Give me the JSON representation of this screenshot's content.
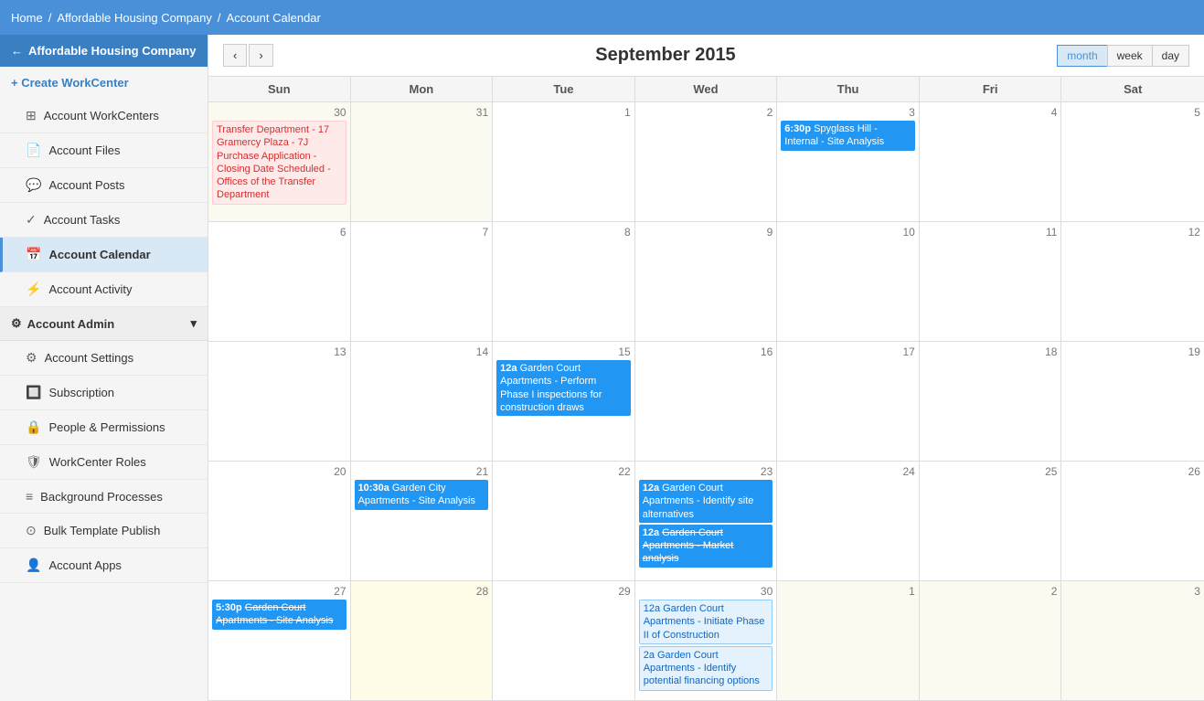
{
  "topBar": {
    "home": "Home",
    "sep1": "/",
    "company": "Affordable Housing Company",
    "sep2": "/",
    "page": "Account Calendar"
  },
  "sidebar": {
    "companyName": "Affordable Housing Company",
    "createBtn": "+ Create WorkCenter",
    "items": [
      {
        "id": "workcenters",
        "icon": "⊞",
        "label": "Account WorkCenters",
        "active": false
      },
      {
        "id": "files",
        "icon": "📄",
        "label": "Account Files",
        "active": false
      },
      {
        "id": "posts",
        "icon": "💬",
        "label": "Account Posts",
        "active": false
      },
      {
        "id": "tasks",
        "icon": "✓",
        "label": "Account Tasks",
        "active": false
      },
      {
        "id": "calendar",
        "icon": "📅",
        "label": "Account Calendar",
        "active": true
      },
      {
        "id": "activity",
        "icon": "⚡",
        "label": "Account Activity",
        "active": false
      }
    ],
    "adminSection": {
      "label": "Account Admin",
      "icon": "⚙",
      "items": [
        {
          "id": "settings",
          "icon": "⚙",
          "label": "Account Settings"
        },
        {
          "id": "subscription",
          "icon": "🔲",
          "label": "Subscription"
        },
        {
          "id": "people",
          "icon": "🔒",
          "label": "People & Permissions"
        },
        {
          "id": "roles",
          "icon": "🛡",
          "label": "WorkCenter Roles"
        },
        {
          "id": "background",
          "icon": "≡",
          "label": "Background Processes"
        },
        {
          "id": "bulk",
          "icon": "⊙",
          "label": "Bulk Template Publish"
        },
        {
          "id": "apps",
          "icon": "👤",
          "label": "Account Apps"
        }
      ]
    }
  },
  "calendar": {
    "title": "September 2015",
    "prevBtn": "‹",
    "nextBtn": "›",
    "views": [
      {
        "id": "month",
        "label": "month",
        "active": true
      },
      {
        "id": "week",
        "label": "week",
        "active": false
      },
      {
        "id": "day",
        "label": "day",
        "active": false
      }
    ],
    "dayNames": [
      "Sun",
      "Mon",
      "Tue",
      "Wed",
      "Thu",
      "Fri",
      "Sat"
    ],
    "weeks": [
      {
        "days": [
          {
            "num": "30",
            "otherMonth": true,
            "today": false,
            "events": [
              {
                "type": "red-text",
                "time": "",
                "title": "Transfer Department - 17 Gramercy Plaza - 7J Purchase Application - Closing Date Scheduled - Offices of the Transfer Department",
                "strikethrough": false
              }
            ]
          },
          {
            "num": "31",
            "otherMonth": true,
            "today": false,
            "events": []
          },
          {
            "num": "1",
            "otherMonth": false,
            "today": false,
            "events": []
          },
          {
            "num": "2",
            "otherMonth": false,
            "today": false,
            "events": []
          },
          {
            "num": "3",
            "otherMonth": false,
            "today": false,
            "events": [
              {
                "type": "blue-fill",
                "time": "6:30p",
                "title": "Spyglass Hill - Internal - Site Analysis",
                "strikethrough": false
              }
            ]
          },
          {
            "num": "4",
            "otherMonth": false,
            "today": false,
            "events": []
          },
          {
            "num": "5",
            "otherMonth": false,
            "today": false,
            "events": []
          }
        ]
      },
      {
        "days": [
          {
            "num": "6",
            "otherMonth": false,
            "today": false,
            "events": []
          },
          {
            "num": "7",
            "otherMonth": false,
            "today": false,
            "events": []
          },
          {
            "num": "8",
            "otherMonth": false,
            "today": false,
            "events": []
          },
          {
            "num": "9",
            "otherMonth": false,
            "today": false,
            "events": []
          },
          {
            "num": "10",
            "otherMonth": false,
            "today": false,
            "events": []
          },
          {
            "num": "11",
            "otherMonth": false,
            "today": false,
            "events": []
          },
          {
            "num": "12",
            "otherMonth": false,
            "today": false,
            "events": []
          }
        ]
      },
      {
        "days": [
          {
            "num": "13",
            "otherMonth": false,
            "today": false,
            "events": []
          },
          {
            "num": "14",
            "otherMonth": false,
            "today": false,
            "events": []
          },
          {
            "num": "15",
            "otherMonth": false,
            "today": false,
            "events": [
              {
                "type": "blue-fill",
                "time": "12a",
                "title": "Garden Court Apartments - Perform Phase I inspections for construction draws",
                "strikethrough": false
              }
            ]
          },
          {
            "num": "16",
            "otherMonth": false,
            "today": false,
            "events": []
          },
          {
            "num": "17",
            "otherMonth": false,
            "today": false,
            "events": []
          },
          {
            "num": "18",
            "otherMonth": false,
            "today": false,
            "events": []
          },
          {
            "num": "19",
            "otherMonth": false,
            "today": false,
            "events": []
          }
        ]
      },
      {
        "days": [
          {
            "num": "20",
            "otherMonth": false,
            "today": false,
            "events": []
          },
          {
            "num": "21",
            "otherMonth": false,
            "today": false,
            "events": [
              {
                "type": "blue-fill",
                "time": "10:30a",
                "title": "Garden City Apartments - Site Analysis",
                "strikethrough": false
              }
            ]
          },
          {
            "num": "22",
            "otherMonth": false,
            "today": false,
            "events": []
          },
          {
            "num": "23",
            "otherMonth": false,
            "today": false,
            "events": [
              {
                "type": "blue-fill",
                "time": "12a",
                "title": "Garden Court Apartments - Identify site alternatives",
                "strikethrough": false
              },
              {
                "type": "blue-fill strikethrough",
                "time": "12a",
                "title": "Garden Court Apartments - Market analysis",
                "strikethrough": true
              }
            ]
          },
          {
            "num": "24",
            "otherMonth": false,
            "today": false,
            "events": []
          },
          {
            "num": "25",
            "otherMonth": false,
            "today": false,
            "events": []
          },
          {
            "num": "26",
            "otherMonth": false,
            "today": false,
            "events": []
          }
        ]
      },
      {
        "days": [
          {
            "num": "27",
            "otherMonth": false,
            "today": false,
            "events": [
              {
                "type": "blue-fill strikethrough",
                "time": "5:30p",
                "title": "Garden Court Apartments - Site Analysis",
                "strikethrough": true
              }
            ]
          },
          {
            "num": "28",
            "otherMonth": false,
            "today": true,
            "events": []
          },
          {
            "num": "29",
            "otherMonth": false,
            "today": false,
            "events": []
          },
          {
            "num": "30",
            "otherMonth": false,
            "today": false,
            "events": [
              {
                "type": "blue-outline",
                "time": "12a",
                "title": "Garden Court Apartments - Initiate Phase II of Construction",
                "strikethrough": false
              },
              {
                "type": "blue-outline",
                "time": "2a",
                "title": "Garden Court Apartments - Identify potential financing options",
                "strikethrough": false
              }
            ]
          },
          {
            "num": "1",
            "otherMonth": true,
            "today": false,
            "events": []
          },
          {
            "num": "2",
            "otherMonth": true,
            "today": false,
            "events": []
          },
          {
            "num": "3",
            "otherMonth": true,
            "today": false,
            "events": []
          }
        ]
      }
    ]
  }
}
